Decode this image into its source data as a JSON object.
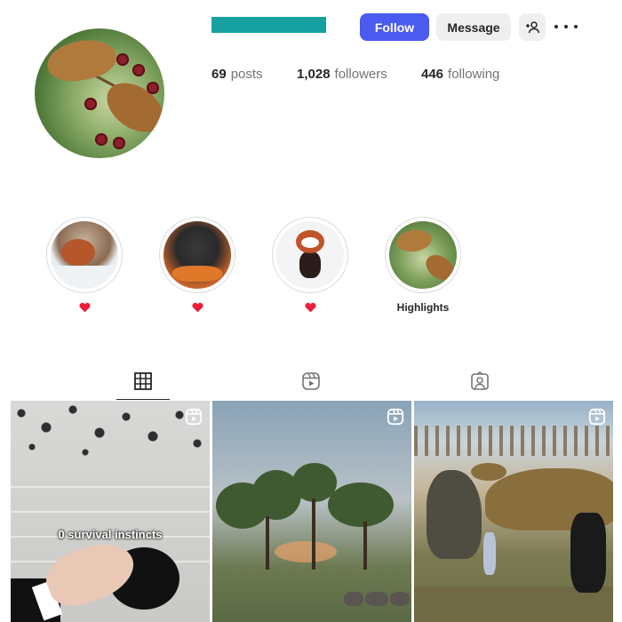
{
  "header": {
    "follow_label": "Follow",
    "message_label": "Message",
    "add_user_icon": "add-user-icon",
    "more_icon": "more-options-icon"
  },
  "stats": {
    "posts_count": "69",
    "posts_label": "posts",
    "followers_count": "1,028",
    "followers_label": "followers",
    "following_count": "446",
    "following_label": "following"
  },
  "highlights": [
    {
      "label": "",
      "icon": "heart-icon"
    },
    {
      "label": "",
      "icon": "heart-icon"
    },
    {
      "label": "",
      "icon": "heart-icon"
    },
    {
      "label": "Highlights",
      "icon": ""
    }
  ],
  "tabs": [
    {
      "icon": "grid-icon",
      "active": true
    },
    {
      "icon": "reels-icon",
      "active": false
    },
    {
      "icon": "tagged-icon",
      "active": false
    }
  ],
  "posts": [
    {
      "caption": "0 survival instincts",
      "badge": "reel-icon"
    },
    {
      "caption": "",
      "badge": "reel-icon"
    },
    {
      "caption": "",
      "badge": "reel-icon"
    }
  ],
  "colors": {
    "accent": "#4a5bf0",
    "username_redaction": "#17a0a0",
    "heart": "#ed1c3a",
    "muted_text": "#737373"
  }
}
